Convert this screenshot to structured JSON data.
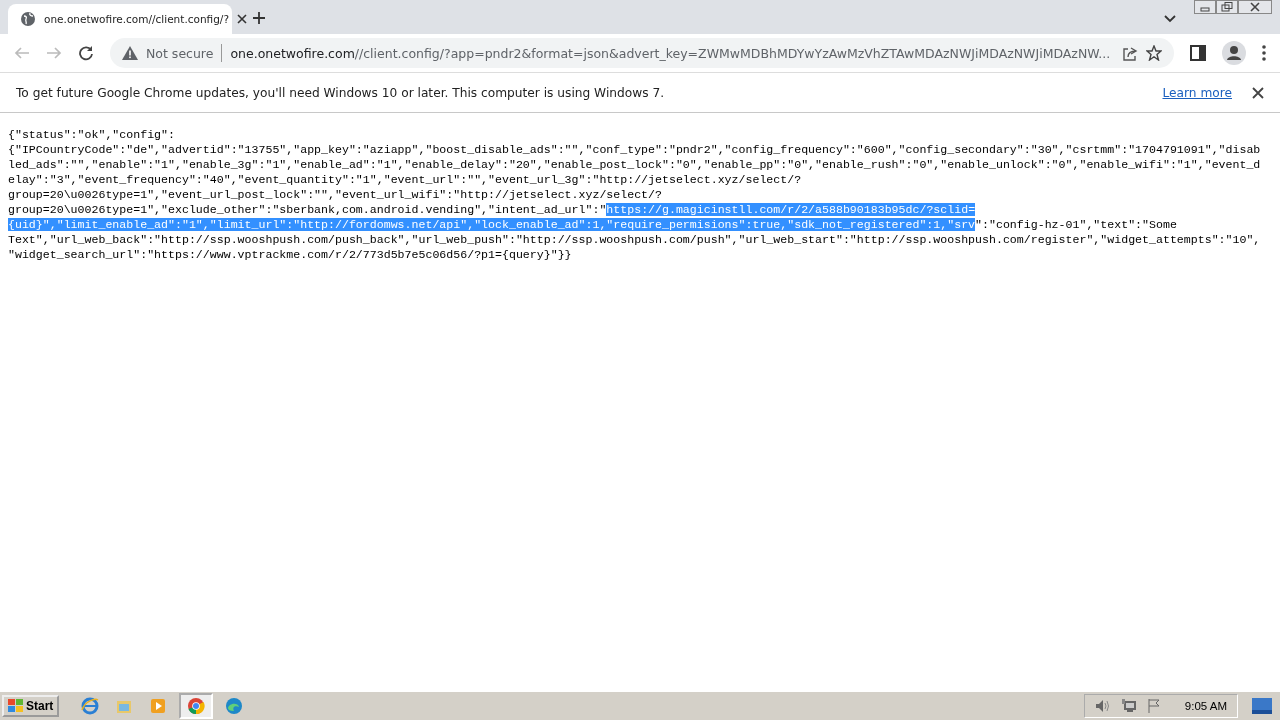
{
  "tabs": [
    {
      "title": "one.onetwofire.com//client.config/?",
      "selected": true
    }
  ],
  "address_bar": {
    "security": "Not secure",
    "url_host": "one.onetwofire.com",
    "url_rest": "//client.config/?app=pndr2&format=json&advert_key=ZWMwMDBhMDYwYzAwMzVhZTAwMDAzNWJiMDAzNWJiMDAzNW..."
  },
  "infobar": {
    "message": "To get future Google Chrome updates, you'll need Windows 10 or later. This computer is using Windows 7.",
    "link": "Learn more"
  },
  "content": [
    {
      "segments": [
        {
          "text": "{\"status\":\"ok\",\"config\":",
          "selected": false
        }
      ]
    },
    {
      "segments": [
        {
          "text": "{\"IPCountryCode\":\"de\",\"advertid\":\"13755\",\"app_key\":\"aziapp\",\"boost_disable_ads\":\"\",\"conf_type\":\"pndr2\",\"config_frequency\":\"600\",\"config_secondary\":\"30\",\"csrtmm\":\"1704791091\",\"disab",
          "selected": false
        }
      ]
    },
    {
      "segments": [
        {
          "text": "led_ads\":\"\",\"enable\":\"1\",\"enable_3g\":\"1\",\"enable_ad\":\"1\",\"enable_delay\":\"20\",\"enable_post_lock\":\"0\",\"enable_pp\":\"0\",\"enable_rush\":\"0\",\"enable_unlock\":\"0\",\"enable_wifi\":\"1\",\"event_d",
          "selected": false
        }
      ]
    },
    {
      "segments": [
        {
          "text": "elay\":\"3\",\"event_frequency\":\"40\",\"event_quantity\":\"1\",\"event_url\":\"\",\"event_url_3g\":\"http://jetselect.xyz/select/?",
          "selected": false
        }
      ]
    },
    {
      "segments": [
        {
          "text": "group=20\\u0026type=1\",\"event_url_post_lock\":\"\",\"event_url_wifi\":\"http://jetselect.xyz/select/?",
          "selected": false
        }
      ]
    },
    {
      "segments": [
        {
          "text": "group=20\\u0026type=1\",\"exclude_other\":\"sberbank,com.android.vending\",\"intent_ad_url\":\"",
          "selected": false
        },
        {
          "text": "https://g.magicinstll.com/r/2/a588b90183b95dc/?sclid=",
          "selected": true
        }
      ]
    },
    {
      "segments": [
        {
          "text": "{uid}\",\"limit_enable_ad\":\"1\",\"limit_url\":\"http://fordomws.net/api\",\"lock_enable_ad\":1,\"require_permisions\":true,\"sdk_not_registered\":1,\"srv",
          "selected": true
        },
        {
          "text": "\":\"config-hz-01\",\"text\":\"Some",
          "selected": false
        }
      ]
    },
    {
      "segments": [
        {
          "text": "Text\",\"url_web_back\":\"http://ssp.wooshpush.com/push_back\",\"url_web_push\":\"http://ssp.wooshpush.com/push\",\"url_web_start\":\"http://ssp.wooshpush.com/register\",\"widget_attempts\":\"10\",",
          "selected": false
        }
      ]
    },
    {
      "segments": [
        {
          "text": "\"widget_search_url\":\"https://www.vptrackme.com/r/2/773d5b7e5c06d56/?p1={query}\"}}",
          "selected": false
        }
      ]
    }
  ],
  "taskbar": {
    "start": "Start",
    "apps": [
      {
        "kind": "ie",
        "selected": false
      },
      {
        "kind": "folder",
        "selected": false
      },
      {
        "kind": "media",
        "selected": false
      },
      {
        "kind": "chrome",
        "selected": true
      },
      {
        "kind": "edge",
        "selected": false
      }
    ],
    "clock": "9:05 AM"
  }
}
